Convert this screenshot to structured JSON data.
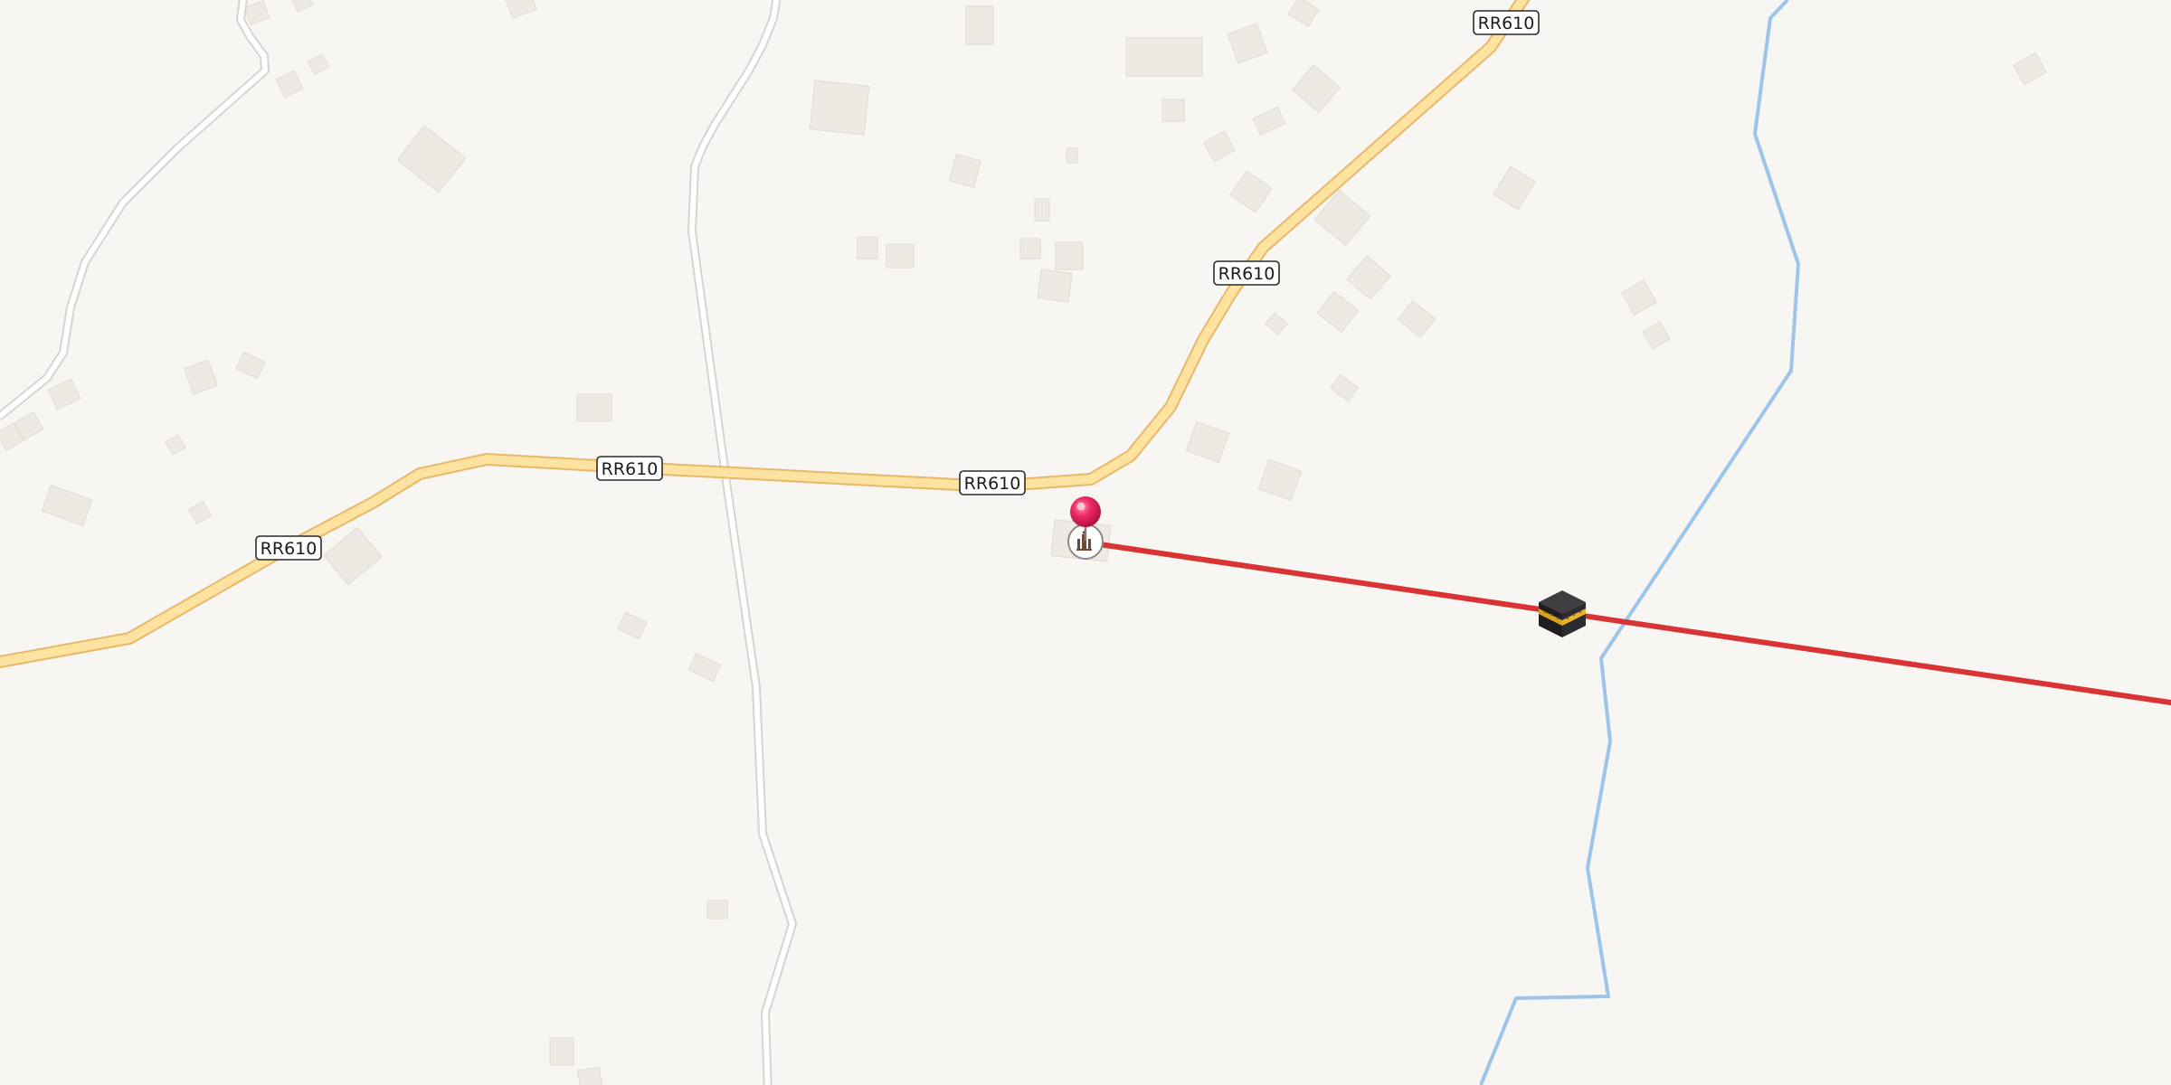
{
  "map": {
    "type": "street-map",
    "route_line_color": "#d93333",
    "major_road_color": "#fde2a0",
    "major_road_casing_color": "#e8b86a",
    "minor_road_color": "#ffffff",
    "minor_road_casing_color": "#d8d4cf",
    "waterway_color": "#9cc5ec",
    "background_color": "#f8f6f3",
    "road_shields": [
      {
        "label": "RR610"
      },
      {
        "label": "RR610"
      },
      {
        "label": "RR610"
      },
      {
        "label": "RR610"
      },
      {
        "label": "RR610"
      }
    ],
    "markers": {
      "location_pin": {
        "icon": "location-pin-icon",
        "color": "#e8225f"
      },
      "mosque": {
        "icon": "mosque-icon"
      },
      "kaaba": {
        "icon": "kaaba-icon"
      }
    }
  }
}
